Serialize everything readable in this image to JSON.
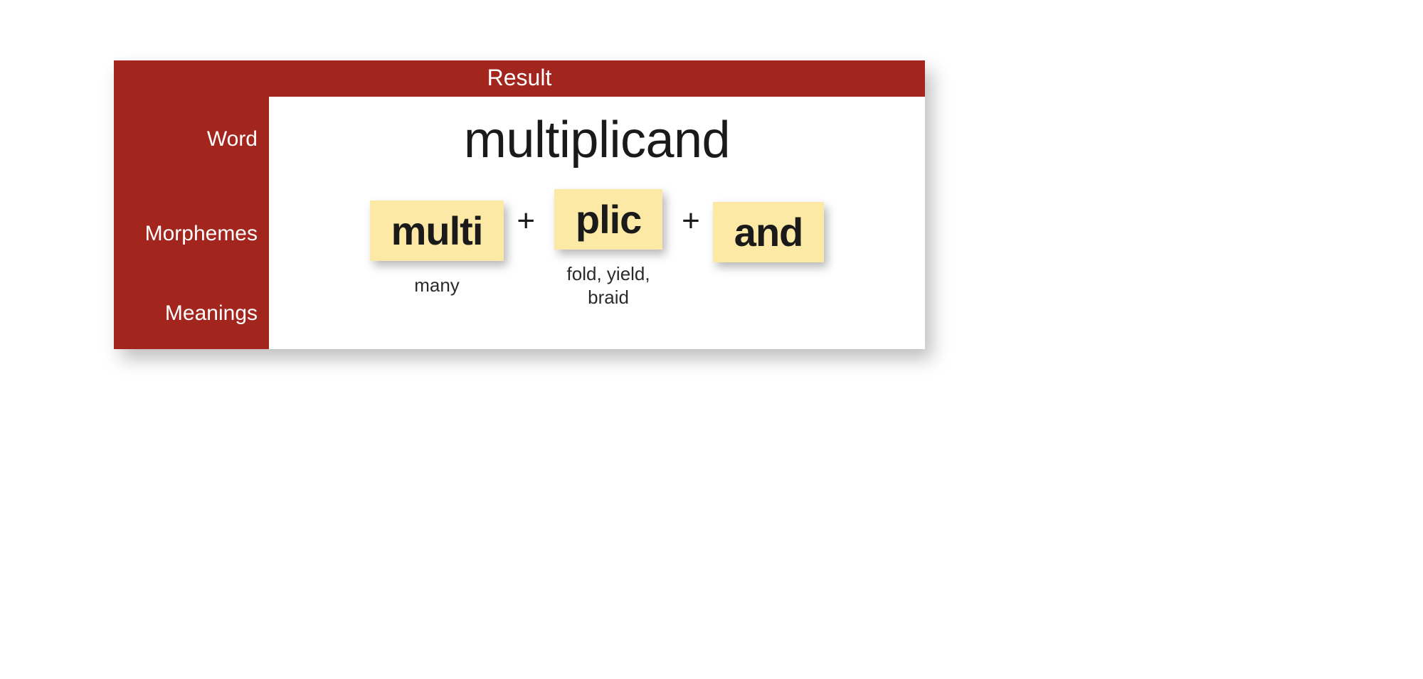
{
  "header": {
    "title": "Result"
  },
  "labels": {
    "word": "Word",
    "morphemes": "Morphemes",
    "meanings": "Meanings"
  },
  "result": {
    "word": "multiplicand",
    "morphemes": [
      {
        "text": "multi",
        "meaning": "many"
      },
      {
        "text": "plic",
        "meaning": "fold, yield, braid"
      },
      {
        "text": "and",
        "meaning": ""
      }
    ],
    "separator": "+"
  }
}
